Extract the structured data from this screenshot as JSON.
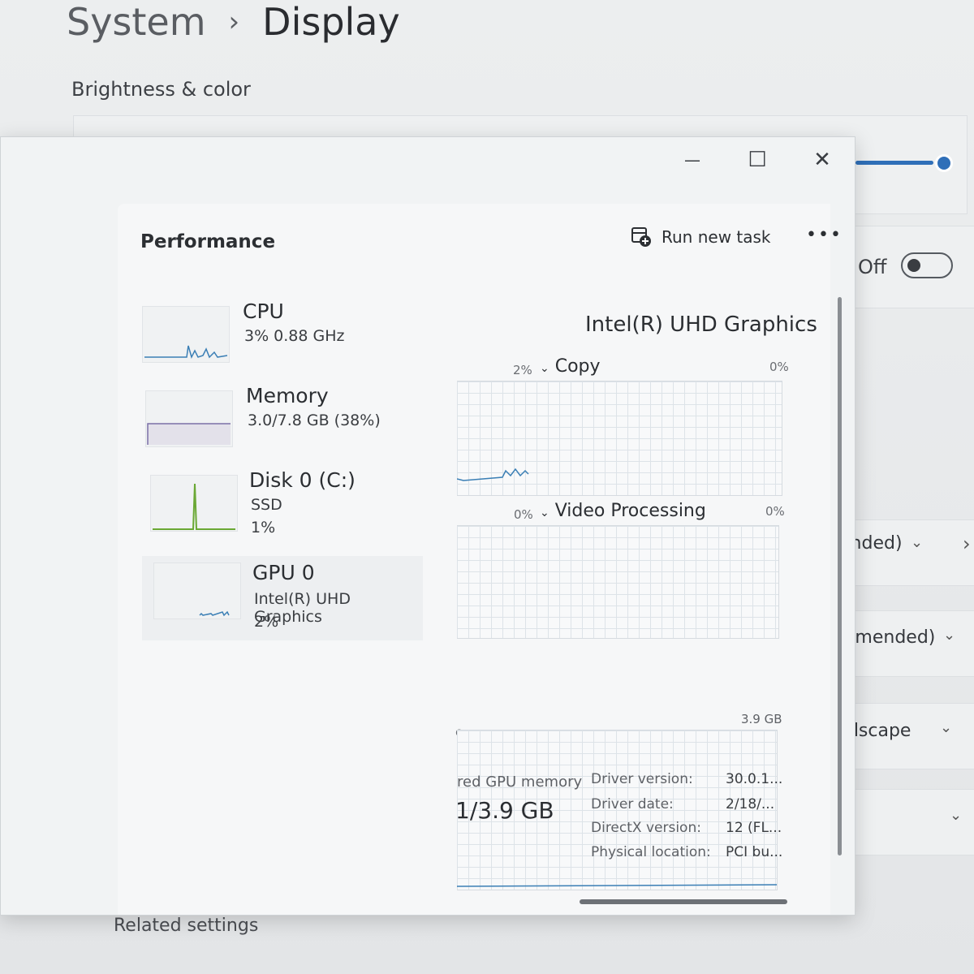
{
  "settings": {
    "breadcrumb_parent": "System",
    "breadcrumb_separator": "›",
    "breadcrumb_current": "Display",
    "section_title": "Brightness & color",
    "toggle_label": "Off",
    "dropdown_1": "ended)",
    "dropdown_2": "mmended)",
    "dropdown_3": "ndscape",
    "related_settings": "Related settings"
  },
  "window": {
    "minimize_glyph": "—",
    "maximize_glyph": "☐",
    "close_glyph": "✕"
  },
  "performance": {
    "title": "Performance",
    "run_new_task": "Run new task",
    "more_glyph": "•••"
  },
  "sidebar": {
    "cpu": {
      "name": "CPU",
      "detail": "3% 0.88 GHz"
    },
    "memory": {
      "name": "Memory",
      "detail": "3.0/7.8 GB (38%)"
    },
    "disk": {
      "name": "Disk 0 (C:)",
      "type": "SSD",
      "usage": "1%"
    },
    "gpu": {
      "name": "GPU 0",
      "model": "Intel(R) UHD Graphics",
      "usage": "2%"
    }
  },
  "gpu_detail": {
    "device_name": "Intel(R) UHD Graphics",
    "copy": {
      "left_pct": "2%",
      "label": "Copy",
      "right_pct": "0%"
    },
    "video_processing": {
      "left_pct": "0%",
      "label": "Video Processing",
      "right_pct": "0%"
    },
    "memory_partial_label": "e",
    "memory_max": "3.9 GB",
    "shared_memory_label": "red GPU memory",
    "shared_memory_value": "1/3.9 GB",
    "info": [
      {
        "label": "Driver version:",
        "value": "30.0.1..."
      },
      {
        "label": "Driver date:",
        "value": "2/18/..."
      },
      {
        "label": "DirectX version:",
        "value": "12 (FL..."
      },
      {
        "label": "Physical location:",
        "value": "PCI bu..."
      }
    ]
  },
  "colors": {
    "accent": "#2f6fb8",
    "cpu_line": "#3b7fb5",
    "memory_line": "#7a6fa8",
    "disk_line": "#6aa834",
    "gpu_line": "#3b7fb5"
  }
}
